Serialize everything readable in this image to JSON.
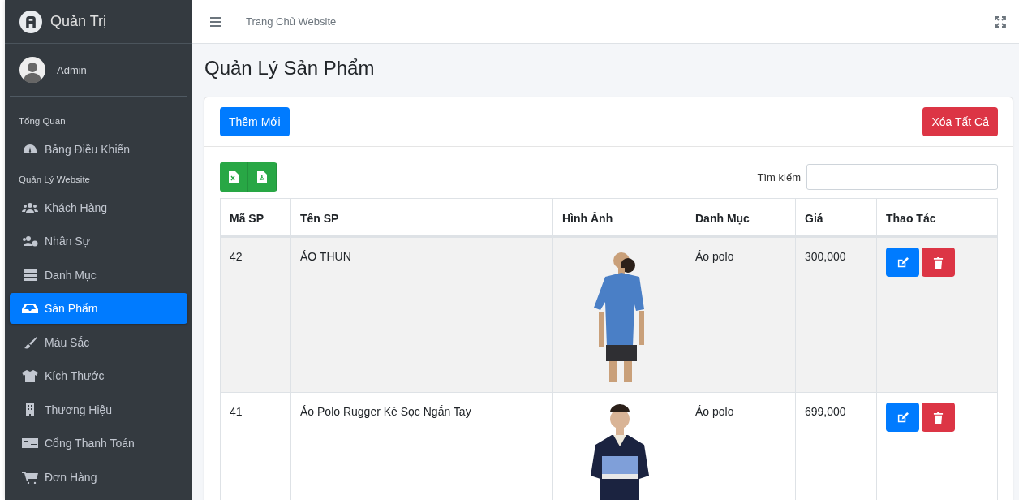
{
  "sidebar": {
    "brand": "Quản Trị",
    "user": "Admin",
    "sections": [
      {
        "heading": "Tổng Quan",
        "items": [
          {
            "label": "Bảng Điều Khiển",
            "selected": false
          }
        ]
      },
      {
        "heading": "Quản Lý Website",
        "items": [
          {
            "label": "Khách Hàng",
            "selected": false
          },
          {
            "label": "Nhân Sự",
            "selected": false
          },
          {
            "label": "Danh Mục",
            "selected": false
          },
          {
            "label": "Sản Phẩm",
            "selected": true
          },
          {
            "label": "Màu Sắc",
            "selected": false
          },
          {
            "label": "Kích Thước",
            "selected": false
          },
          {
            "label": "Thương Hiệu",
            "selected": false
          },
          {
            "label": "Cổng Thanh Toán",
            "selected": false
          },
          {
            "label": "Đơn Hàng",
            "selected": false
          }
        ]
      }
    ]
  },
  "topbar": {
    "link": "Trang Chủ Website"
  },
  "page_title": "Quản Lý Sản Phẩm",
  "card": {
    "add_button": "Thêm Mới",
    "delete_all_button": "Xóa Tất Cả",
    "search_label": "Tìm kiếm",
    "table": {
      "columns": [
        "Mã SP",
        "Tên SP",
        "Hình Ảnh",
        "Danh Mục",
        "Giá",
        "Thao Tác"
      ],
      "rows": [
        {
          "id": "42",
          "name": "ÁO THUN",
          "category": "Áo polo",
          "price": "300,000"
        },
        {
          "id": "41",
          "name": "Áo Polo Rugger Kẻ Sọc Ngắn Tay",
          "category": "Áo polo",
          "price": "699,000"
        }
      ]
    }
  }
}
